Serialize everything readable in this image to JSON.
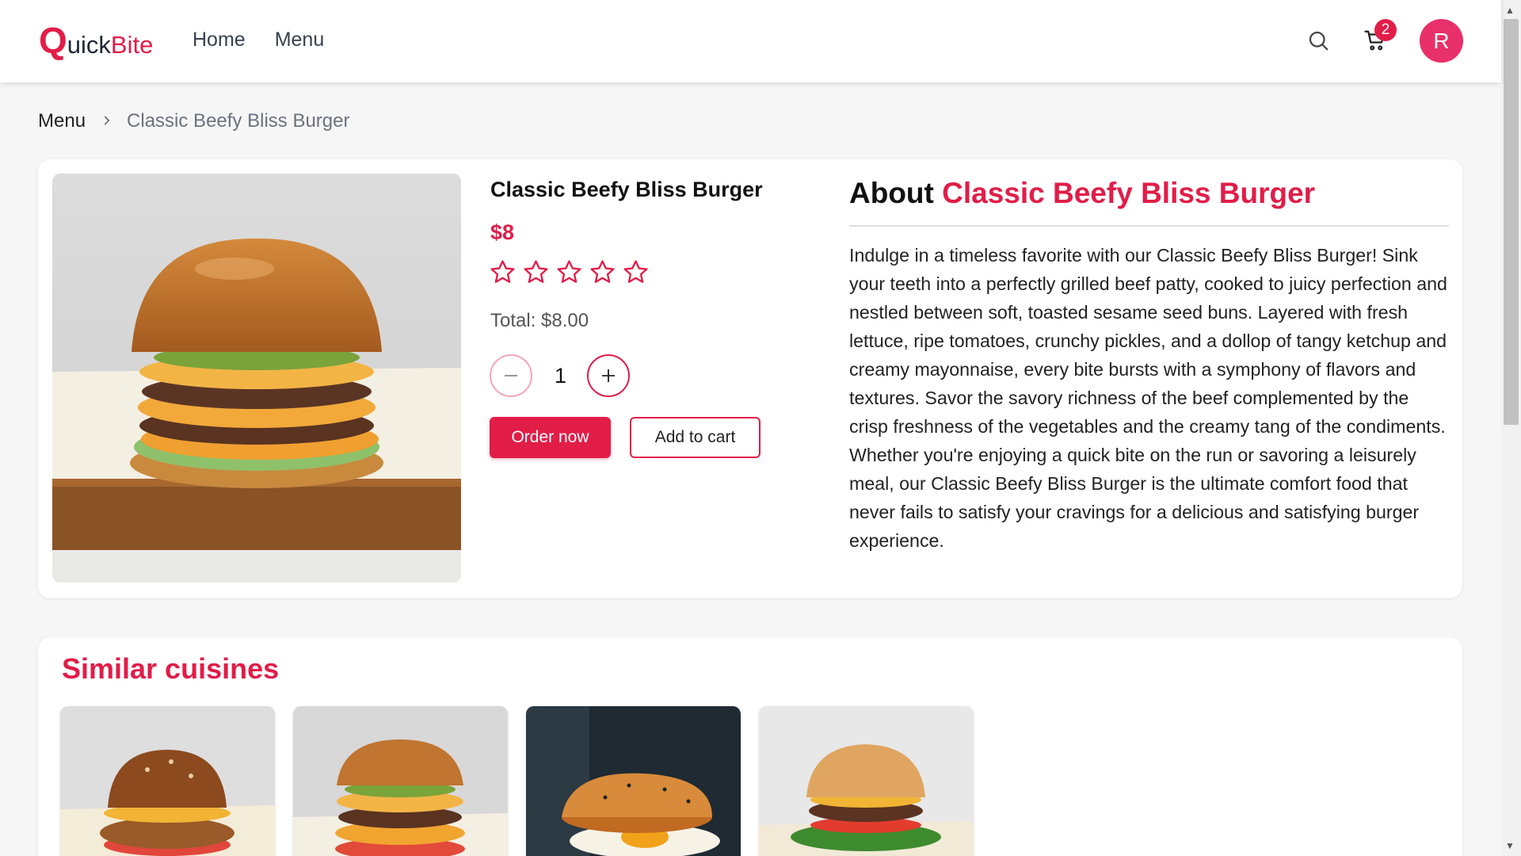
{
  "header": {
    "logo_q": "Q",
    "logo_uick": "uick",
    "logo_bite": "Bite",
    "nav": [
      {
        "label": "Home"
      },
      {
        "label": "Menu"
      }
    ],
    "cart_count": "2",
    "avatar_initial": "R",
    "icons": {
      "search": "search-icon",
      "cart": "cart-icon"
    }
  },
  "breadcrumb": {
    "root": "Menu",
    "current": "Classic Beefy Bliss Burger",
    "separator_icon": "chevron-right-icon"
  },
  "product": {
    "name": "Classic Beefy Bliss Burger",
    "price": "$8",
    "rating": 0,
    "max_rating": 5,
    "total": "Total: $8.00",
    "quantity": "1",
    "order_label": "Order now",
    "add_to_cart_label": "Add to cart"
  },
  "about": {
    "prefix": "About",
    "highlight": "Classic Beefy Bliss Burger",
    "text": "Indulge in a timeless favorite with our Classic Beefy Bliss Burger! Sink your teeth into a perfectly grilled beef patty, cooked to juicy perfection and nestled between soft, toasted sesame seed buns. Layered with fresh lettuce, ripe tomatoes, crunchy pickles, and a dollop of tangy ketchup and creamy mayonnaise, every bite bursts with a symphony of flavors and textures. Savor the savory richness of the beef complemented by the crisp freshness of the vegetables and the creamy tang of the condiments. Whether you're enjoying a quick bite on the run or savoring a leisurely meal, our Classic Beefy Bliss Burger is the ultimate comfort food that never fails to satisfy your cravings for a delicious and satisfying burger experience."
  },
  "similar": {
    "title": "Similar cuisines"
  },
  "colors": {
    "brand": "#e11d48",
    "avatar": "#e8316a",
    "page_bg": "#f6f6f6"
  }
}
